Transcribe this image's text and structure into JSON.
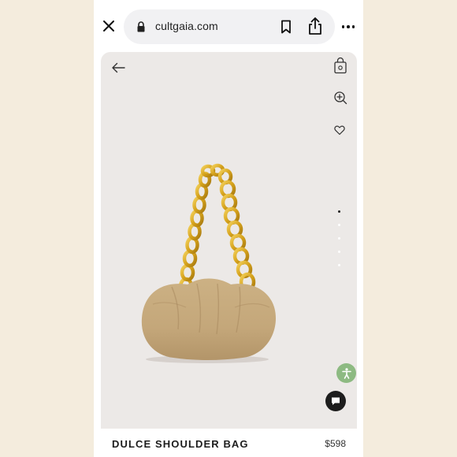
{
  "browser": {
    "url": "cultgaia.com",
    "close_icon": "close-icon",
    "lock_icon": "lock-icon",
    "bookmark_icon": "bookmark-icon",
    "share_icon": "share-icon",
    "more_icon": "more-horizontal-icon"
  },
  "product": {
    "name": "DULCE SHOULDER BAG",
    "price": "$598",
    "image_count": 5,
    "active_image": 1,
    "icons": [
      "back-arrow-icon",
      "shopping-bag-icon",
      "zoom-in-icon",
      "heart-icon"
    ]
  },
  "floating": {
    "accessibility_icon": "accessibility-icon",
    "chat_icon": "chat-icon"
  },
  "colors": {
    "page_background": "#f4ecdd",
    "card_background": "#ece9e7",
    "bag_tan": "#c9ad80",
    "chain_gold": "#d6a623",
    "accessibility_green": "#8dba82",
    "chat_dark": "#1d1d1d"
  }
}
